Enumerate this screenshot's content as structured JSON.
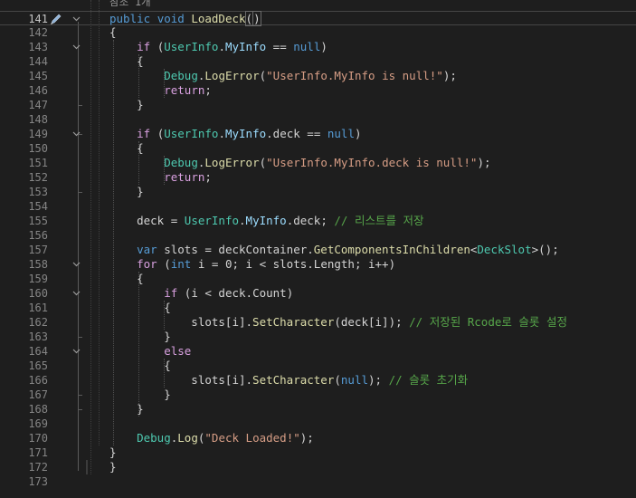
{
  "code_lens": "참조 1개",
  "lines": [
    {
      "n": "141",
      "tokens": [
        {
          "t": "public",
          "c": "kw"
        },
        {
          "t": " "
        },
        {
          "t": "void",
          "c": "kw"
        },
        {
          "t": " "
        },
        {
          "t": "LoadDeck",
          "c": "meth"
        },
        {
          "t": "("
        },
        {
          "t": ")"
        }
      ]
    },
    {
      "n": "142",
      "tokens": [
        {
          "t": "{"
        }
      ]
    },
    {
      "n": "143",
      "tokens": [
        {
          "t": "    "
        },
        {
          "t": "if",
          "c": "ctrl"
        },
        {
          "t": " ("
        },
        {
          "t": "UserInfo",
          "c": "type"
        },
        {
          "t": "."
        },
        {
          "t": "MyInfo",
          "c": "var"
        },
        {
          "t": " == "
        },
        {
          "t": "null",
          "c": "kw"
        },
        {
          "t": ")"
        }
      ]
    },
    {
      "n": "144",
      "tokens": [
        {
          "t": "    {"
        }
      ]
    },
    {
      "n": "145",
      "tokens": [
        {
          "t": "        "
        },
        {
          "t": "Debug",
          "c": "type"
        },
        {
          "t": "."
        },
        {
          "t": "LogError",
          "c": "meth"
        },
        {
          "t": "("
        },
        {
          "t": "\"UserInfo.MyInfo is null!\"",
          "c": "str"
        },
        {
          "t": ");"
        }
      ]
    },
    {
      "n": "146",
      "tokens": [
        {
          "t": "        "
        },
        {
          "t": "return",
          "c": "ctrl"
        },
        {
          "t": ";"
        }
      ]
    },
    {
      "n": "147",
      "tokens": [
        {
          "t": "    }"
        }
      ]
    },
    {
      "n": "148",
      "tokens": []
    },
    {
      "n": "149",
      "tokens": [
        {
          "t": "    "
        },
        {
          "t": "if",
          "c": "ctrl"
        },
        {
          "t": " ("
        },
        {
          "t": "UserInfo",
          "c": "type"
        },
        {
          "t": "."
        },
        {
          "t": "MyInfo",
          "c": "var"
        },
        {
          "t": ".deck == "
        },
        {
          "t": "null",
          "c": "kw"
        },
        {
          "t": ")"
        }
      ]
    },
    {
      "n": "150",
      "tokens": [
        {
          "t": "    {"
        }
      ]
    },
    {
      "n": "151",
      "tokens": [
        {
          "t": "        "
        },
        {
          "t": "Debug",
          "c": "type"
        },
        {
          "t": "."
        },
        {
          "t": "LogError",
          "c": "meth"
        },
        {
          "t": "("
        },
        {
          "t": "\"UserInfo.MyInfo.deck is null!\"",
          "c": "str"
        },
        {
          "t": ");"
        }
      ]
    },
    {
      "n": "152",
      "tokens": [
        {
          "t": "        "
        },
        {
          "t": "return",
          "c": "ctrl"
        },
        {
          "t": ";"
        }
      ]
    },
    {
      "n": "153",
      "tokens": [
        {
          "t": "    }"
        }
      ]
    },
    {
      "n": "154",
      "tokens": []
    },
    {
      "n": "155",
      "tokens": [
        {
          "t": "    deck = "
        },
        {
          "t": "UserInfo",
          "c": "type"
        },
        {
          "t": "."
        },
        {
          "t": "MyInfo",
          "c": "var"
        },
        {
          "t": ".deck; "
        },
        {
          "t": "// 리스트를 저장",
          "c": "cmt"
        }
      ]
    },
    {
      "n": "156",
      "tokens": []
    },
    {
      "n": "157",
      "tokens": [
        {
          "t": "    "
        },
        {
          "t": "var",
          "c": "kw"
        },
        {
          "t": " slots = deckContainer."
        },
        {
          "t": "GetComponentsInChildren",
          "c": "meth"
        },
        {
          "t": "<"
        },
        {
          "t": "DeckSlot",
          "c": "type"
        },
        {
          "t": ">();"
        }
      ]
    },
    {
      "n": "158",
      "tokens": [
        {
          "t": "    "
        },
        {
          "t": "for",
          "c": "ctrl"
        },
        {
          "t": " ("
        },
        {
          "t": "int",
          "c": "kw"
        },
        {
          "t": " i = 0; i < slots.Length; i++)"
        }
      ]
    },
    {
      "n": "159",
      "tokens": [
        {
          "t": "    {"
        }
      ]
    },
    {
      "n": "160",
      "tokens": [
        {
          "t": "        "
        },
        {
          "t": "if",
          "c": "ctrl"
        },
        {
          "t": " (i < deck.Count)"
        }
      ]
    },
    {
      "n": "161",
      "tokens": [
        {
          "t": "        {"
        }
      ]
    },
    {
      "n": "162",
      "tokens": [
        {
          "t": "            slots[i]."
        },
        {
          "t": "SetCharacter",
          "c": "meth"
        },
        {
          "t": "(deck[i]); "
        },
        {
          "t": "// 저장된 Rcode로 슬롯 설정",
          "c": "cmt"
        }
      ]
    },
    {
      "n": "163",
      "tokens": [
        {
          "t": "        }"
        }
      ]
    },
    {
      "n": "164",
      "tokens": [
        {
          "t": "        "
        },
        {
          "t": "else",
          "c": "ctrl"
        }
      ]
    },
    {
      "n": "165",
      "tokens": [
        {
          "t": "        {"
        }
      ]
    },
    {
      "n": "166",
      "tokens": [
        {
          "t": "            slots[i]."
        },
        {
          "t": "SetCharacter",
          "c": "meth"
        },
        {
          "t": "("
        },
        {
          "t": "null",
          "c": "kw"
        },
        {
          "t": "); "
        },
        {
          "t": "// 슬롯 초기화",
          "c": "cmt"
        }
      ]
    },
    {
      "n": "167",
      "tokens": [
        {
          "t": "        }"
        }
      ]
    },
    {
      "n": "168",
      "tokens": [
        {
          "t": "    }"
        }
      ]
    },
    {
      "n": "169",
      "tokens": []
    },
    {
      "n": "170",
      "tokens": [
        {
          "t": "    "
        },
        {
          "t": "Debug",
          "c": "type"
        },
        {
          "t": "."
        },
        {
          "t": "Log",
          "c": "meth"
        },
        {
          "t": "("
        },
        {
          "t": "\"Deck Loaded!\"",
          "c": "str"
        },
        {
          "t": ");"
        }
      ]
    },
    {
      "n": "171",
      "tokens": [
        {
          "t": "}"
        }
      ]
    },
    {
      "n": "172",
      "tokens": [
        {
          "t": "}"
        }
      ]
    },
    {
      "n": "173",
      "tokens": []
    }
  ],
  "fold_lines": [
    "141",
    "143",
    "149",
    "158",
    "160",
    "164"
  ],
  "current_line": "141",
  "icons": {
    "quick_action": "pencil-icon",
    "fold": "chevron-down-icon"
  },
  "colors": {
    "background": "#1e1e1e",
    "keyword": "#569cd6",
    "control": "#d8a0df",
    "type": "#4ec9b0",
    "method": "#dcdcaa",
    "string": "#d69d85",
    "comment": "#57a64a",
    "line_number": "#858585"
  }
}
